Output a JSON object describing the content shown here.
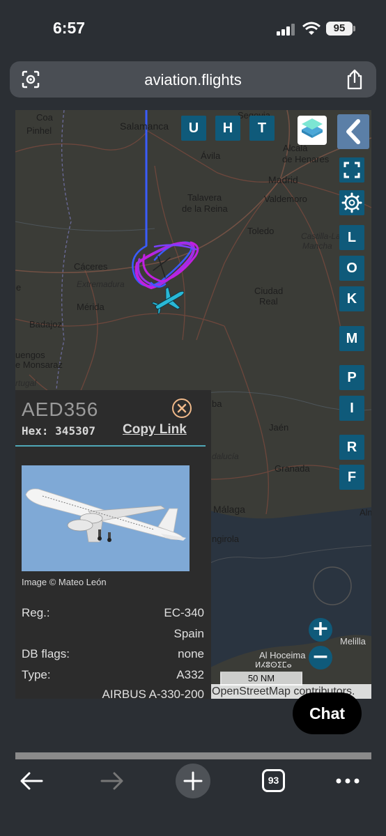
{
  "status_bar": {
    "time": "6:57",
    "battery": "95"
  },
  "browser": {
    "url": "aviation.flights",
    "tab_count": "93"
  },
  "map": {
    "top_buttons": [
      "U",
      "H",
      "T"
    ],
    "side_buttons": [
      "L",
      "O",
      "K",
      "M",
      "P",
      "I",
      "R",
      "F"
    ],
    "cities": {
      "coa": "Coa",
      "pinhel": "Pinhel",
      "salamanca": "Salamanca",
      "segovia": "Segovia",
      "avila": "Ávila",
      "alcala": "Alcalá",
      "henares": "de Henares",
      "madrid": "Madrid",
      "talavera1": "Talavera",
      "talavera2": "de la Reina",
      "valdemoro": "Valdemoro",
      "toledo": "Toledo",
      "castilla1": "Castilla-La",
      "castilla2": "Mancha",
      "caceres": "Cáceres",
      "extremadura": "Extremadura",
      "ciudad1": "Ciudad",
      "ciudad2": "Real",
      "merida": "Mérida",
      "badajoz": "Badajoz",
      "uengos": "uengos",
      "monsaraz": "e Monsaraz",
      "rtugal": "rtugal",
      "e_left": "e",
      "ba": "ba",
      "jaen": "Jaén",
      "andalucia": "dalucía",
      "granada": "Granada",
      "malaga": "Málaga",
      "alm": "Alm",
      "ngirola": "ngirola",
      "melilla": "Melilla",
      "hoceima": "Al Hoceima",
      "hoceima_ar": "ⵍⵃⵓⵙⵉⵎⴰ"
    },
    "scale_label": "50 NM",
    "attribution": "OpenStreetMap contributors.",
    "zoom_in": "+",
    "zoom_out": "−"
  },
  "aircraft": {
    "callsign": "AED356",
    "hex_label": "Hex:",
    "hex": "345307",
    "copy_link": "Copy Link",
    "photo_credit": "Image © Mateo León",
    "reg_label": "Reg.:",
    "reg": "EC-340",
    "country": "Spain",
    "db_flags_label": "DB flags:",
    "db_flags": "none",
    "type_label": "Type:",
    "type": "A332",
    "type_full": "AIRBUS A-330-200"
  },
  "chat_label": "Chat",
  "colors": {
    "button_teal": "#0f5a7a",
    "track_blue": "#3a5cff",
    "track_magenta": "#c020e0",
    "plane_cyan": "#29b8d6",
    "divider": "#4fa8b8"
  }
}
